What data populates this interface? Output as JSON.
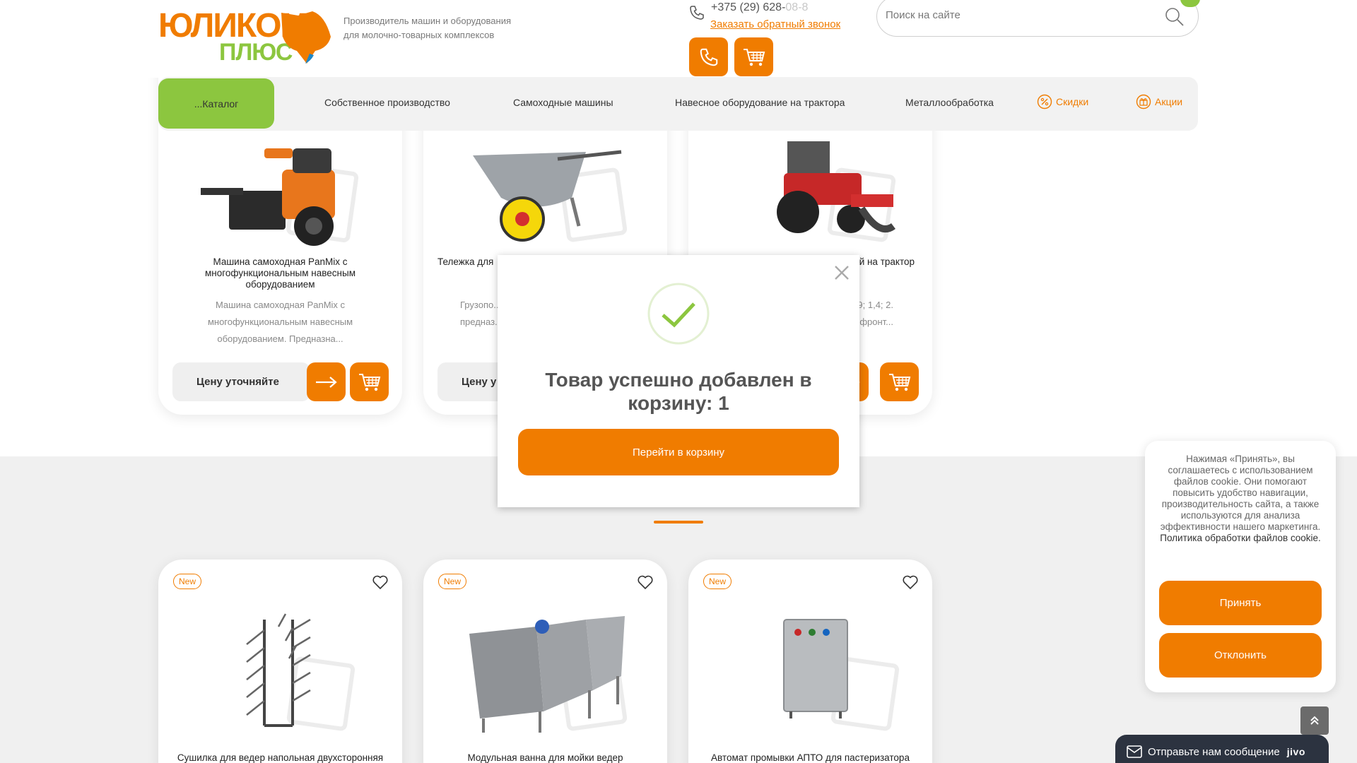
{
  "header": {
    "logo_line1": "ЮЛИКОМ",
    "logo_line2": "ПЛЮС",
    "tagline": "Производитель машин и оборудования для молочно-товарных комплексов",
    "phone_main": "+375 (29) 628-",
    "phone_faded": "08-8",
    "callback_label": "Заказать обратный звонок",
    "search_placeholder": "Поиск на сайте"
  },
  "nav": {
    "catalog": "...Каталог",
    "items": [
      {
        "label": "Собственное производство"
      },
      {
        "label": "Самоходные машины"
      },
      {
        "label": "Навесное оборудование на трактора"
      },
      {
        "label": "Металлообработка"
      },
      {
        "label": "Скидки"
      },
      {
        "label": "Акции"
      }
    ]
  },
  "products_top": [
    {
      "title": "Машина самоходная PanMix с многофункциональным навесным оборудованием",
      "desc": "Машина самоходная PanMix с многофункциональным навесным оборудованием. Предназна...",
      "price_label": "Цену уточняйте"
    },
    {
      "title": "Тележка для",
      "desc": "Грузопо... предназ...",
      "price_label": "Цену у"
    },
    {
      "title": "й на трактор",
      "desc": "; 0,9; 1,4; 2. фронт..."
    }
  ],
  "products_bottom": [
    {
      "badge": "New",
      "title": "Сушилка для ведер напольная двухсторонняя"
    },
    {
      "badge": "New",
      "title": "Модульная ванна для мойки ведер"
    },
    {
      "badge": "New",
      "title": "Автомат промывки АПТО для пастеризатора"
    }
  ],
  "modal": {
    "title": "Товар успешно добавлен в корзину: 1",
    "button": "Перейти в корзину"
  },
  "cookie": {
    "text": "Нажимая «Принять», вы соглашаетесь с использованием файлов cookie. Они помогают повысить удобство навигации, производительность сайта, а также используются для анализа эффективности нашего маркетинга.",
    "link": "Политика обработки файлов cookie.",
    "accept": "Принять",
    "decline": "Отклонить"
  },
  "chat": {
    "label": "Отправьте нам сообщение",
    "brand": "jivo"
  },
  "colors": {
    "accent": "#f07c00",
    "green": "#8cc63f",
    "chat_bg": "#2c3340"
  }
}
